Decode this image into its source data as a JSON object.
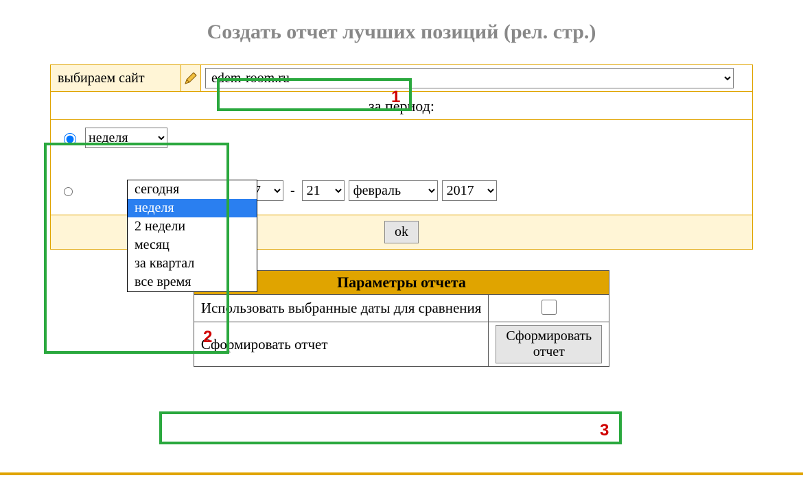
{
  "page": {
    "title": "Создать отчет лучших позиций (рел. стр.)"
  },
  "site_row": {
    "label": "выбираем сайт",
    "selected": "edem-room.ru"
  },
  "period": {
    "caption": "за период:",
    "mode_preset_selected": true,
    "preset_select_visible": "неделя",
    "preset_options": [
      "сегодня",
      "неделя",
      "2 недели",
      "месяц",
      "за квартал",
      "все время"
    ],
    "selected_preset_index": 1,
    "date_from": {
      "day": "",
      "month": "",
      "year": "2017"
    },
    "date_to": {
      "day": "21",
      "month": "февраль",
      "year": "2017"
    }
  },
  "ok_button": "ok",
  "params_table": {
    "header": "Параметры отчета",
    "rows": [
      {
        "label": "Использовать выбранные даты для сравнения",
        "checkbox": false
      },
      {
        "label": "Сформировать отчет",
        "button": "Сформировать отчет"
      }
    ]
  },
  "annotations": {
    "n1": "1",
    "n2": "2",
    "n3": "3"
  }
}
